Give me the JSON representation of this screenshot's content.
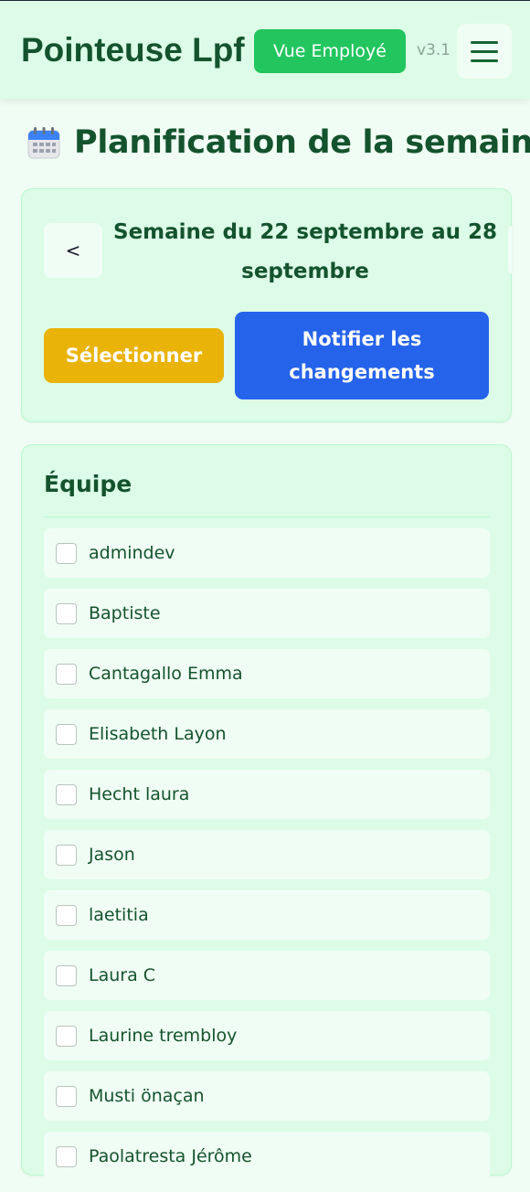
{
  "header": {
    "app_title": "Pointeuse Lpf",
    "role_badge": "Vue Employé",
    "version": "v3.1",
    "menu_icon": "hamburger-menu-icon"
  },
  "page": {
    "icon": "calendar-icon",
    "title": "Planification de la semaine"
  },
  "week": {
    "prev_label": "<",
    "label": "Semaine du 22 septembre au 28 septembre",
    "select_label": "Sélectionner",
    "notify_label": "Notifier les changements"
  },
  "team": {
    "title": "Équipe",
    "members": [
      {
        "name": "admindev",
        "checked": false
      },
      {
        "name": "Baptiste",
        "checked": false
      },
      {
        "name": "Cantagallo Emma",
        "checked": false
      },
      {
        "name": "Elisabeth Layon",
        "checked": false
      },
      {
        "name": "Hecht laura",
        "checked": false
      },
      {
        "name": "Jason",
        "checked": false
      },
      {
        "name": "laetitia",
        "checked": false
      },
      {
        "name": "Laura C",
        "checked": false
      },
      {
        "name": "Laurine trembloy",
        "checked": false
      },
      {
        "name": "Musti önaçan",
        "checked": false
      },
      {
        "name": "Paolatresta Jérôme",
        "checked": false
      }
    ]
  },
  "colors": {
    "background": "#f0fdf4",
    "card": "#dcfce7",
    "primary_text": "#14532d",
    "badge_green": "#22c55e",
    "select_yellow": "#eab308",
    "notify_blue": "#2563eb"
  }
}
